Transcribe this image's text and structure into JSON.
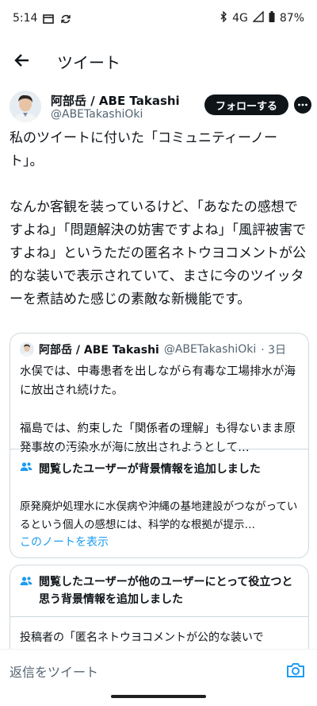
{
  "status": {
    "time": "5:14",
    "network": "4G",
    "battery": "87%"
  },
  "header": {
    "title": "ツイート"
  },
  "author": {
    "name": "阿部岳 / ABE Takashi",
    "handle": "@ABETakashiOki",
    "follow_label": "フォローする"
  },
  "tweet": {
    "text": "私のツイートに付いた「コミュニティーノート」。\n\nなんか客観を装っているけど、「あなたの感想ですよね」「問題解決の妨害ですよね」「風評被害ですよね」というただの匿名ネトウヨコメントが公的な装いで表示されていて、まさに今のツイッターを煮詰めた感じの素敵な新機能です。"
  },
  "quoted": {
    "name": "阿部岳 / ABE Takashi",
    "handle": "@ABETakashiOki",
    "time": "· 3日",
    "text": "水俣では、中毒患者を出しながら有毒な工場排水が海に放出され続けた。\n\n福島では、約束した「関係者の理解」も得ないまま原発事故の汚染水が海に放出されようとして…",
    "note_heading": "閲覧したユーザーが背景情報を追加しました",
    "note_body": "原発廃炉処理水に水俣病や沖縄の基地建設がつながっているという個人の感想には、科学的な根拠が提示…",
    "note_link": "このノートを表示"
  },
  "note2": {
    "heading": "閲覧したユーザーが他のユーザーにとって役立つと思う背景情報を追加しました",
    "body": "投稿者の「匿名ネトウヨコメントが公的な装いで"
  },
  "reply": {
    "placeholder": "返信をツイート"
  },
  "colors": {
    "accent": "#1d9bf0",
    "text": "#0f1419",
    "secondary": "#536471",
    "border": "#cfd9de"
  },
  "icons": [
    "gallery-icon",
    "sync-icon",
    "bluetooth-icon",
    "signal-icon",
    "battery-icon",
    "back-arrow-icon",
    "more-icon",
    "people-icon",
    "camera-icon"
  ]
}
